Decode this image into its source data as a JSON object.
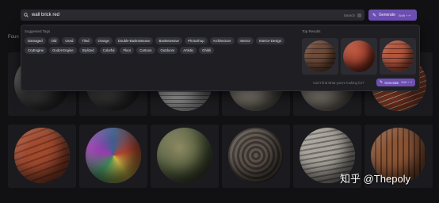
{
  "search": {
    "query": "wall brick red",
    "hint": "Search"
  },
  "generate": {
    "label": "Generate",
    "shortcut": "Shift + ↵"
  },
  "found": "Foun",
  "dropdown": {
    "tags_title": "Suggested Tags",
    "tags": [
      "Damaged",
      "Old",
      "Used",
      "Tiled",
      "Orange",
      "Double-Basketweave",
      "Basketweave",
      "Photoshop",
      "Architecture",
      "Interior",
      "Interior-Design",
      "CryEngine",
      "Godot-Engine",
      "Stylized",
      "Colorful",
      "Floor",
      "Cartoon",
      "Outdoors",
      "Artistic",
      "Ghibli"
    ],
    "results_title": "Top Results",
    "cant_find": "Can't find what you're looking for?",
    "generate_label": "Generate",
    "generate_shortcut": "Shift + ↵"
  },
  "watermark": "知乎 @Thepoly",
  "colors": {
    "accent": "#6d4fb2",
    "background": "#111114",
    "panel": "#1f1f23"
  }
}
